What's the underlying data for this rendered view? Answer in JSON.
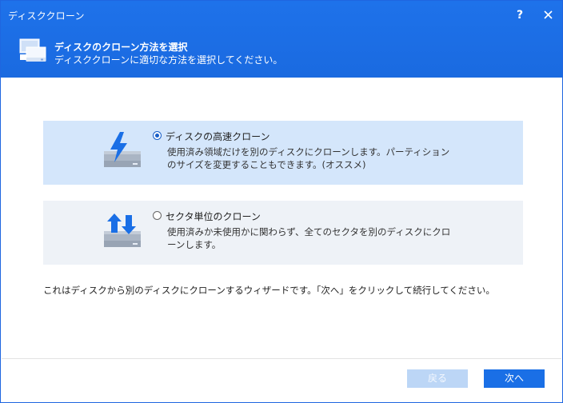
{
  "window": {
    "title": "ディスククローン",
    "help_label": "?",
    "header_title": "ディスクのクローン方法を選択",
    "header_subtitle": "ディスククローンに適切な方法を選択してください。"
  },
  "options": [
    {
      "title": "ディスクの高速クローン",
      "description": "使用済み領域だけを別のディスクにクローンします。パーティションのサイズを変更することもできます。(オススメ)",
      "selected": true,
      "icon": "lightning-disk-icon"
    },
    {
      "title": "セクタ単位のクローン",
      "description": "使用済みか未使用かに関わらず、全てのセクタを別のディスクにクローンします。",
      "selected": false,
      "icon": "arrows-disk-icon"
    }
  ],
  "footer_note": "これはディスクから別のディスクにクローンするウィザードです。「次へ」をクリックして続行してください。",
  "buttons": {
    "back": "戻る",
    "next": "次へ"
  },
  "colors": {
    "titlebar": "#1a6fe6",
    "selected_option_bg": "#d4e6fb",
    "option_bg": "#eef2f7",
    "disabled_button": "#bcd6f6"
  }
}
